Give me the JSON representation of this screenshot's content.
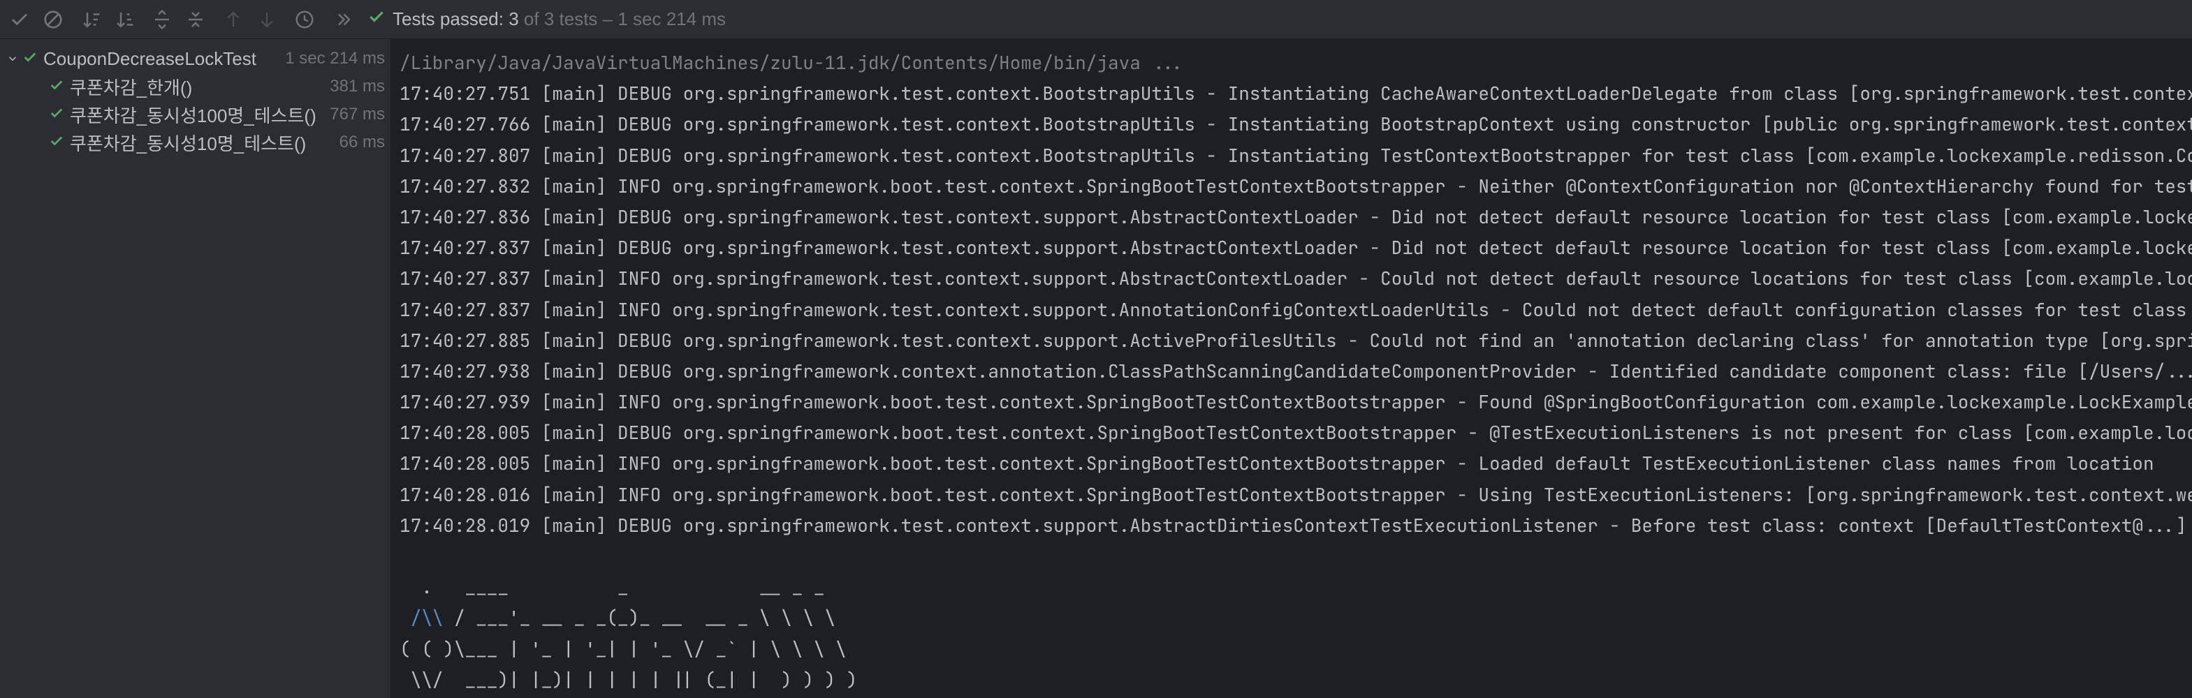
{
  "toolbar": {
    "status_prefix": "Tests passed:",
    "passed_count": "3",
    "of_text": "of 3 tests –",
    "duration": "1 sec 214 ms"
  },
  "tree": {
    "root": {
      "name": "CouponDecreaseLockTest",
      "duration": "1 sec 214 ms"
    },
    "children": [
      {
        "name": "쿠폰차감_한개()",
        "duration": "381 ms"
      },
      {
        "name": "쿠폰차감_동시성100명_테스트()",
        "duration": "767 ms"
      },
      {
        "name": "쿠폰차감_동시성10명_테스트()",
        "duration": "66 ms"
      }
    ]
  },
  "console": {
    "cmd": "/Library/Java/JavaVirtualMachines/zulu-11.jdk/Contents/Home/bin/java ...",
    "lines": [
      "17:40:27.751 [main] DEBUG org.springframework.test.context.BootstrapUtils - Instantiating CacheAwareContextLoaderDelegate from class [org.springframework.test.context.cache.DefaultCacheAwareContextLoaderDelegate]",
      "17:40:27.766 [main] DEBUG org.springframework.test.context.BootstrapUtils - Instantiating BootstrapContext using constructor [public org.springframework.test.context.support.DefaultBootstrapContext]",
      "17:40:27.807 [main] DEBUG org.springframework.test.context.BootstrapUtils - Instantiating TestContextBootstrapper for test class [com.example.lockexample.redisson.CouponDecreaseLockTest]",
      "17:40:27.832 [main] INFO org.springframework.boot.test.context.SpringBootTestContextBootstrapper - Neither @ContextConfiguration nor @ContextHierarchy found for test class",
      "17:40:27.836 [main] DEBUG org.springframework.test.context.support.AbstractContextLoader - Did not detect default resource location for test class [com.example.lockexample]",
      "17:40:27.837 [main] DEBUG org.springframework.test.context.support.AbstractContextLoader - Did not detect default resource location for test class [com.example.lockexample]",
      "17:40:27.837 [main] INFO org.springframework.test.context.support.AbstractContextLoader - Could not detect default resource locations for test class [com.example.lockexample]",
      "17:40:27.837 [main] INFO org.springframework.test.context.support.AnnotationConfigContextLoaderUtils - Could not detect default configuration classes for test class",
      "17:40:27.885 [main] DEBUG org.springframework.test.context.support.ActiveProfilesUtils - Could not find an 'annotation declaring class' for annotation type [org.springframework.test.context.ActiveProfiles]",
      "17:40:27.938 [main] DEBUG org.springframework.context.annotation.ClassPathScanningCandidateComponentProvider - Identified candidate component class: file [/Users/...]",
      "17:40:27.939 [main] INFO org.springframework.boot.test.context.SpringBootTestContextBootstrapper - Found @SpringBootConfiguration com.example.lockexample.LockExampleApplication",
      "17:40:28.005 [main] DEBUG org.springframework.boot.test.context.SpringBootTestContextBootstrapper - @TestExecutionListeners is not present for class [com.example.lockexample]",
      "17:40:28.005 [main] INFO org.springframework.boot.test.context.SpringBootTestContextBootstrapper - Loaded default TestExecutionListener class names from location",
      "17:40:28.016 [main] INFO org.springframework.boot.test.context.SpringBootTestContextBootstrapper - Using TestExecutionListeners: [org.springframework.test.context.web.ServletTestExecutionListener]",
      "17:40:28.019 [main] DEBUG org.springframework.test.context.support.AbstractDirtiesContextTestExecutionListener - Before test class: context [DefaultTestContext@...]"
    ],
    "banner": [
      "  .   ____          _            __ _ _",
      " /\\\\ / ___'_ __ _ _(_)_ __  __ _ \\ \\ \\ \\",
      "( ( )\\___ | '_ | '_| | '_ \\/ _` | \\ \\ \\ \\",
      " \\\\/  ___)| |_)| | | | | || (_| |  ) ) ) )"
    ]
  }
}
